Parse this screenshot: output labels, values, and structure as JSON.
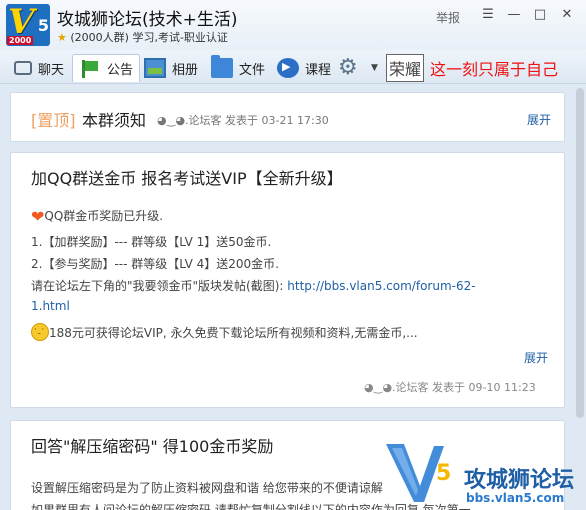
{
  "window": {
    "group_name": "攻城狮论坛(技术+生活)",
    "group_sub": "(2000人群) 学习,考试-职业认证",
    "report": "举报",
    "logo_year": "2000",
    "logo_letter": "V",
    "logo_number": "5",
    "controls": {
      "skin": "☰",
      "minimize": "—",
      "maximize": "□",
      "close": "✕"
    }
  },
  "toolbar": {
    "items": [
      {
        "label": "聊天",
        "icon": "chat-icon"
      },
      {
        "label": "公告",
        "icon": "flag-icon"
      },
      {
        "label": "相册",
        "icon": "photo-icon"
      },
      {
        "label": "文件",
        "icon": "folder-icon"
      },
      {
        "label": "课程",
        "icon": "course-icon"
      }
    ],
    "settings_icon": "gear-icon",
    "slogan_box": "荣耀",
    "slogan_text": "这一刻只属于自己"
  },
  "pinned": {
    "tag": "[置顶]",
    "title": "本群须知",
    "meta": "◕‿◕.论坛客 发表于 03-21 17:30",
    "expand": "展开"
  },
  "notice1": {
    "title": "加QQ群送金币 报名考试送VIP【全新升级】",
    "line1": "QQ群金币奖励已升级.",
    "line2": "1.【加群奖励】--- 群等级【LV 1】送50金币.",
    "line3": "2.【参与奖励】--- 群等级【LV 4】送200金币.",
    "line4_text": "请在论坛左下角的\"我要领金币\"版块发帖(截图): ",
    "line4_link": "http://bbs.vlan5.com/forum-62-",
    "line5_link": "1.html",
    "line6": "188元可获得论坛VIP, 永久免费下载论坛所有视频和资料,无需金币,...",
    "expand": "展开",
    "meta": "◕‿◕.论坛客 发表于 09-10 11:23"
  },
  "notice2": {
    "title": "回答\"解压缩密码\" 得100金币奖励",
    "line1": "设置解压缩密码是为了防止资料被网盘和谐 给您带来的不便请谅解",
    "line2": "如果群里有人问论坛的解压缩密码 请帮忙复制分割线以下的内容作为回复 每次第一"
  },
  "watermark": {
    "brand": "攻城狮论坛",
    "url": "bbs.vlan5.com"
  }
}
